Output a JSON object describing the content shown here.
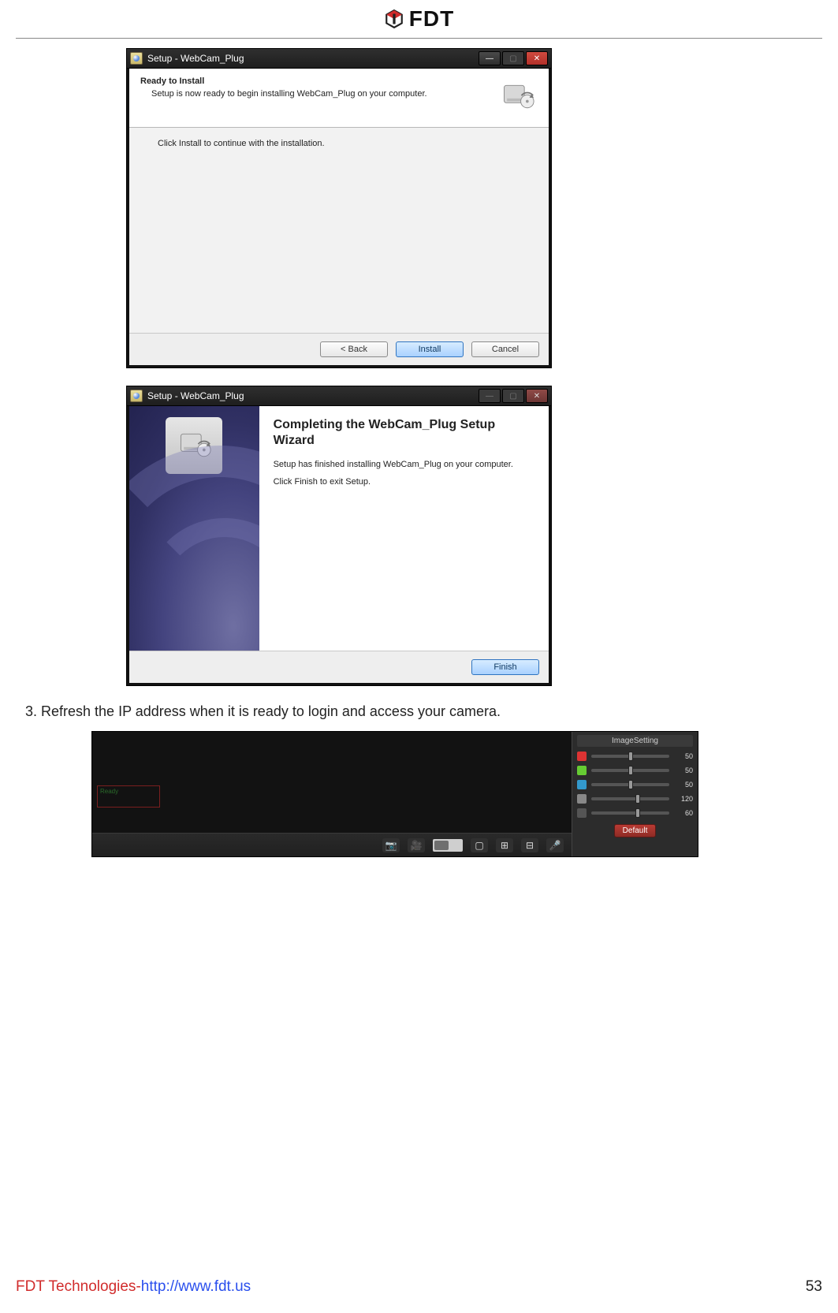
{
  "header": {
    "brand": "FDT"
  },
  "installer1": {
    "window_title": "Setup - WebCam_Plug",
    "heading": "Ready to Install",
    "subheading": "Setup is now ready to begin installing WebCam_Plug on your computer.",
    "body_text": "Click Install to continue with the installation.",
    "buttons": {
      "back": "< Back",
      "install": "Install",
      "cancel": "Cancel"
    }
  },
  "installer2": {
    "window_title": "Setup - WebCam_Plug",
    "heading": "Completing the WebCam_Plug Setup Wizard",
    "body_line1": "Setup has finished installing WebCam_Plug on your computer.",
    "body_line2": "Click Finish to exit Setup.",
    "buttons": {
      "finish": "Finish"
    }
  },
  "step_text": "3. Refresh the IP address when it is ready to login and access your camera.",
  "camera_ui": {
    "ready_label": "Ready",
    "panel_title": "ImageSetting",
    "sliders": [
      {
        "color": "#d33",
        "value": 50,
        "max": 100
      },
      {
        "color": "#6c3",
        "value": 50,
        "max": 100
      },
      {
        "color": "#39c",
        "value": 50,
        "max": 100
      },
      {
        "color": "#888",
        "value": 120,
        "max": 200
      },
      {
        "color": "#555",
        "value": 60,
        "max": 100
      }
    ],
    "default_button": "Default",
    "toolbar_icons": [
      "camera-icon",
      "video-icon",
      "toggle-icon",
      "layout1-icon",
      "layout4-icon",
      "layout9-icon",
      "mic-icon"
    ]
  },
  "footer": {
    "company": "FDT Technologies",
    "url": "http://www.fdt.us",
    "page_number": "53"
  }
}
